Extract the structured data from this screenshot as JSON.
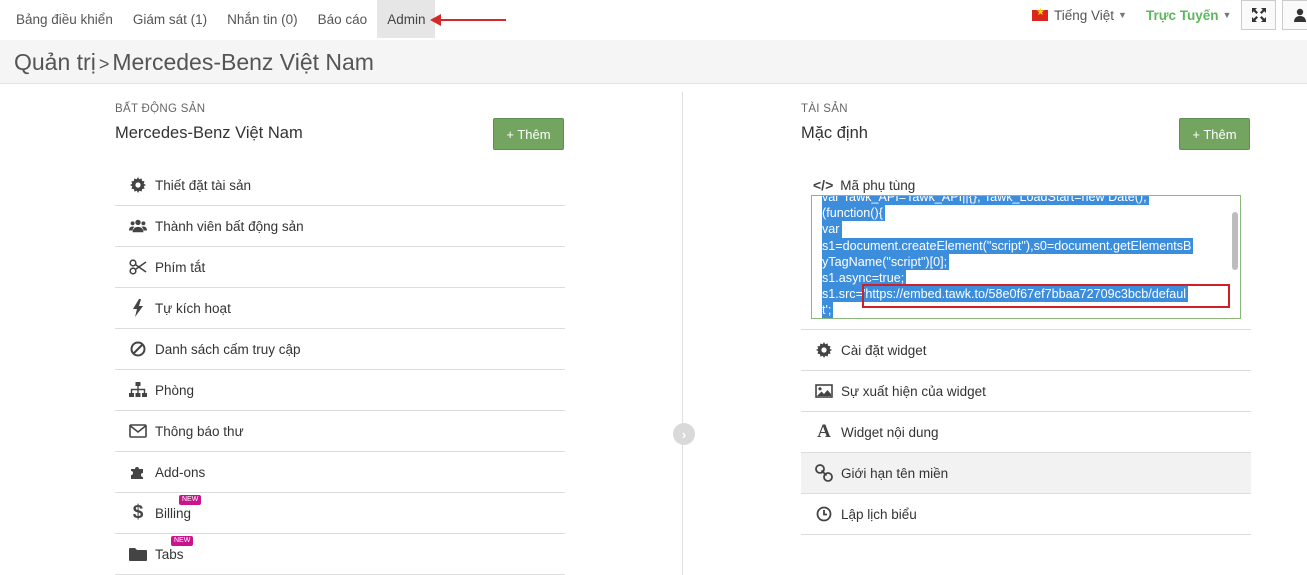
{
  "nav": {
    "tabs": [
      {
        "label": "Bảng điều khiển"
      },
      {
        "label": "Giám sát (1)"
      },
      {
        "label": "Nhắn tin (0)"
      },
      {
        "label": "Báo cáo"
      },
      {
        "label": "Admin"
      }
    ],
    "language": "Tiếng Việt",
    "status": "Trực Tuyến"
  },
  "page": {
    "breadcrumb_root": "Quản trị",
    "breadcrumb_current": "Mercedes-Benz Việt Nam"
  },
  "left": {
    "section_label": "BẤT ĐỘNG SẢN",
    "section_name": "Mercedes-Benz Việt Nam",
    "add_label": "+ Thêm",
    "items": [
      {
        "label": "Thiết đặt tài sản",
        "icon": "gear-icon"
      },
      {
        "label": "Thành viên bất động sản",
        "icon": "users-icon"
      },
      {
        "label": "Phím tắt",
        "icon": "scissors-icon"
      },
      {
        "label": "Tự kích hoạt",
        "icon": "bolt-icon"
      },
      {
        "label": "Danh sách cấm truy cập",
        "icon": "ban-icon"
      },
      {
        "label": "Phòng",
        "icon": "sitemap-icon"
      },
      {
        "label": "Thông báo thư",
        "icon": "envelope-icon"
      },
      {
        "label": "Add-ons",
        "icon": "puzzle-icon"
      },
      {
        "label": "Billing",
        "icon": "dollar-icon",
        "badge": "NEW"
      },
      {
        "label": "Tabs",
        "icon": "folder-icon",
        "badge": "NEW"
      }
    ]
  },
  "right": {
    "section_label": "TÀI SẢN",
    "section_name": "Mặc định",
    "add_label": "+ Thêm",
    "code_title": "Mã phụ tùng",
    "code_lines": [
      "var Tawk_API=Tawk_API||{}, Tawk_LoadStart=new Date();",
      "(function(){",
      "var",
      "s1=document.createElement(\"script\"),s0=document.getElementsB",
      "yTagName(\"script\")[0];",
      "s1.async=true;",
      "s1.src='https://embed.tawk.to/58e0f67ef7bbaa72709c3bcb/defaul",
      "t';",
      ""
    ],
    "items": [
      {
        "label": "Cài đặt widget",
        "icon": "gear-icon"
      },
      {
        "label": "Sự xuất hiện của widget",
        "icon": "image-icon"
      },
      {
        "label": "Widget nội dung",
        "icon": "font-icon"
      },
      {
        "label": "Giới hạn tên miền",
        "icon": "link-icon"
      },
      {
        "label": "Lập lịch biểu",
        "icon": "clock-icon"
      }
    ]
  },
  "colors": {
    "accent_green": "#73a561",
    "status_green": "#5cb85c",
    "selection_blue": "#3d8ddd",
    "annotation_red": "#d11f2a",
    "badge_pink": "#c9148e"
  }
}
